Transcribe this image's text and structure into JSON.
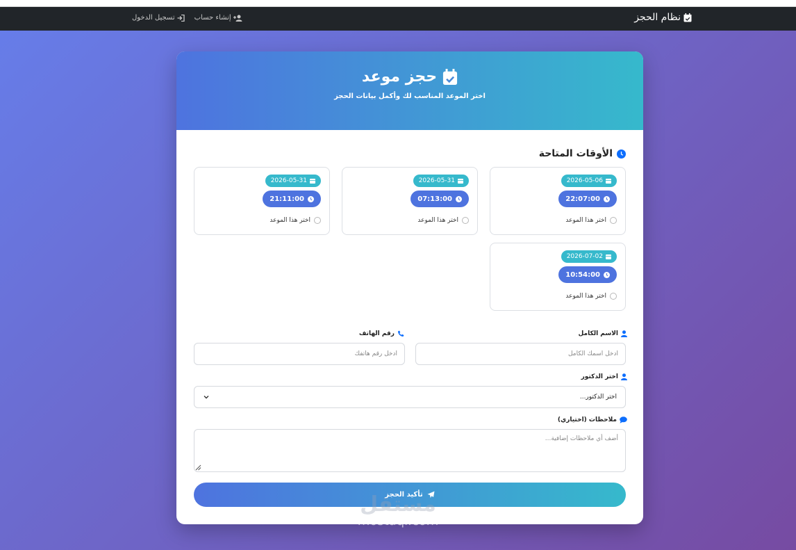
{
  "navbar": {
    "brand": "نظام الحجز",
    "login": "تسجيل الدخول",
    "register": "إنشاء حساب"
  },
  "header": {
    "title": "حجز موعد",
    "subtitle": "اختر الموعد المناسب لك وأكمل بيانات الحجز"
  },
  "slots": {
    "title": "الأوقات المتاحة",
    "items": [
      {
        "date": "2026-05-06",
        "time": "22:07:00",
        "choose": "اختر هذا الموعد"
      },
      {
        "date": "2026-05-31",
        "time": "07:13:00",
        "choose": "اختر هذا الموعد"
      },
      {
        "date": "2026-05-31",
        "time": "21:11:00",
        "choose": "اختر هذا الموعد"
      },
      {
        "date": "2026-07-02",
        "time": "10:54:00",
        "choose": "اختر هذا الموعد"
      }
    ]
  },
  "form": {
    "name_label": "الاسم الكامل",
    "name_placeholder": "أدخل اسمك الكامل",
    "phone_label": "رقم الهاتف",
    "phone_placeholder": "أدخل رقم هاتفك",
    "doctor_label": "اختر الدكتور",
    "doctor_selected": "اختر الدكتور...",
    "notes_label": "ملاحظات (اختياري)",
    "notes_placeholder": "أضف أي ملاحظات إضافية...",
    "submit": "تأكيد الحجز"
  },
  "watermark": {
    "ar": "مستقل",
    "en": "mostaql.com"
  },
  "colors": {
    "primary": "#4e73df",
    "info": "#36b9cc",
    "navbar": "#212529"
  }
}
